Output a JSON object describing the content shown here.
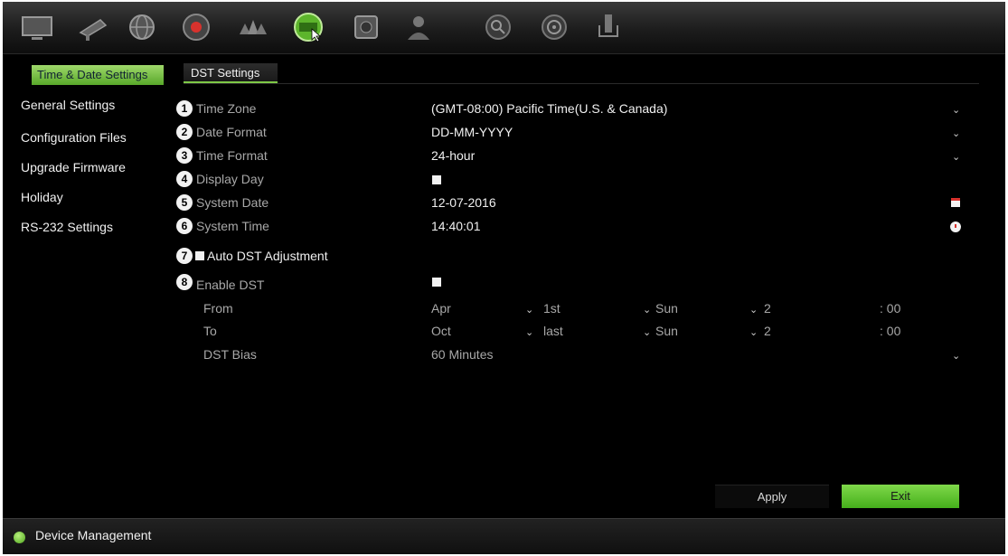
{
  "toolbar": {
    "icons": [
      "monitor-icon",
      "camera-icon",
      "network-icon",
      "record-icon",
      "alarm-icon",
      "device-icon",
      "storage-icon",
      "user-icon",
      "search-icon",
      "playback-icon",
      "shutdown-icon"
    ],
    "active_index": 5
  },
  "sidebar": {
    "items": [
      {
        "label": "Time & Date Settings"
      },
      {
        "label": "General Settings"
      },
      {
        "label": "Configuration Files"
      },
      {
        "label": "Upgrade Firmware"
      },
      {
        "label": "Holiday"
      },
      {
        "label": "RS-232 Settings"
      }
    ]
  },
  "tabs": [
    {
      "label": "DST Settings"
    }
  ],
  "form": {
    "time_zone": {
      "num": "1",
      "label": "Time Zone",
      "value": "(GMT-08:00) Pacific Time(U.S. & Canada)"
    },
    "date_format": {
      "num": "2",
      "label": "Date Format",
      "value": "DD-MM-YYYY"
    },
    "time_format": {
      "num": "3",
      "label": "Time Format",
      "value": "24-hour"
    },
    "display_day": {
      "num": "4",
      "label": "Display Day",
      "checked": true
    },
    "system_date": {
      "num": "5",
      "label": "System Date",
      "value": "12-07-2016"
    },
    "system_time": {
      "num": "6",
      "label": "System Time",
      "value": "14:40:01"
    },
    "auto_dst": {
      "num": "7",
      "label": "Auto DST Adjustment",
      "checked": true
    },
    "enable_dst": {
      "num": "8",
      "label": "Enable DST",
      "checked": true
    },
    "from": {
      "label": "From",
      "month": "Apr",
      "week": "1st",
      "day": "Sun",
      "hour": "2",
      "minutes": ": 00"
    },
    "to": {
      "label": "To",
      "month": "Oct",
      "week": "last",
      "day": "Sun",
      "hour": "2",
      "minutes": ": 00"
    },
    "dst_bias": {
      "label": "DST Bias",
      "value": "60 Minutes"
    }
  },
  "buttons": {
    "apply": "Apply",
    "exit": "Exit"
  },
  "status": {
    "label": "Device Management"
  },
  "colors": {
    "accent": "#6cc73a",
    "background": "#000000",
    "label": "#a8a8a8"
  }
}
